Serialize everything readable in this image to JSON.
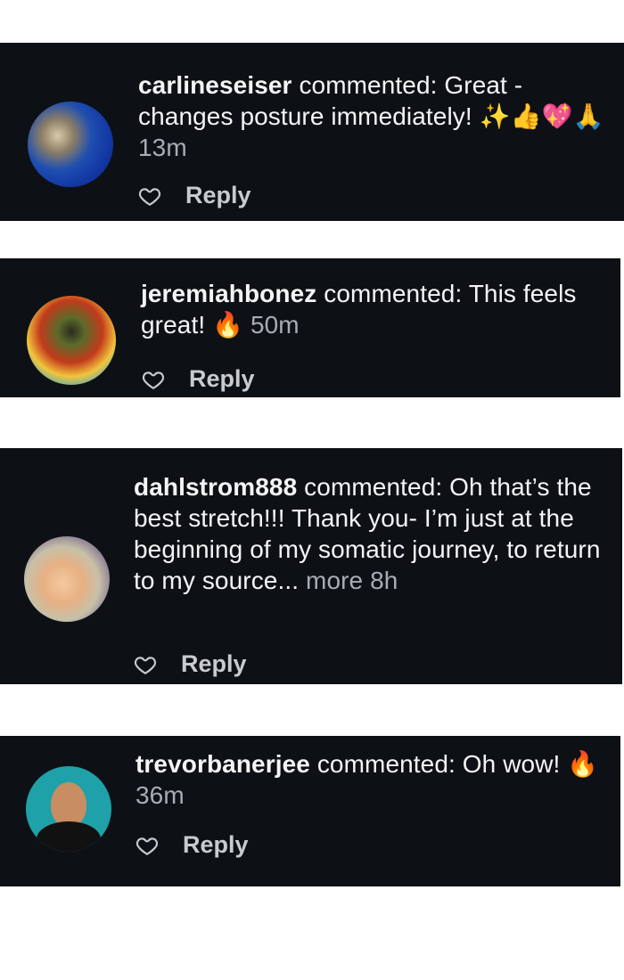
{
  "comments": [
    {
      "username": "carlineseiser",
      "text": "commented: Great - changes posture immediately! ✨👍💖🙏",
      "time": "13m",
      "reply_label": "Reply",
      "avatar_icon": "avatar-photo"
    },
    {
      "username": "jeremiahbonez",
      "text": "commented: This feels great! 🔥",
      "time": "50m",
      "reply_label": "Reply",
      "avatar_icon": "avatar-photo"
    },
    {
      "username": "dahlstrom888",
      "text": "commented: Oh that’s the best stretch!!! Thank you- I’m just at the beginning of my somatic journey, to return to my source...",
      "more_label": "more",
      "time": "8h",
      "reply_label": "Reply",
      "avatar_icon": "avatar-photo"
    },
    {
      "username": "trevorbanerjee",
      "text": "commented: Oh wow! 🔥",
      "time": "36m",
      "reply_label": "Reply",
      "avatar_icon": "avatar-photo"
    }
  ],
  "colors": {
    "card_background": "#0d1116",
    "text_primary": "#f4f4f4",
    "text_secondary": "#a8adb4"
  },
  "icons": {
    "like": "heart-outline-icon"
  }
}
